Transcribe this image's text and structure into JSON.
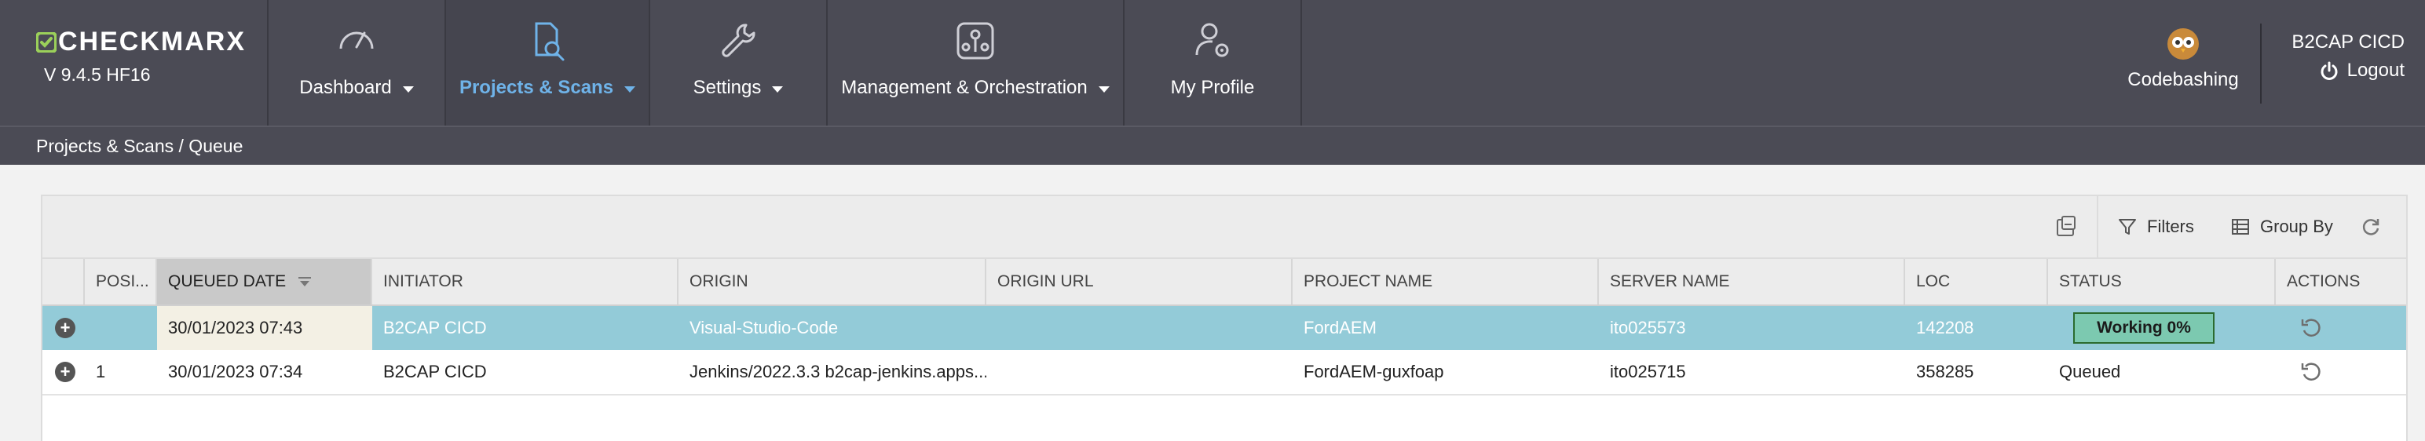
{
  "app": {
    "logo_text": "CHECKMARX",
    "version": "V 9.4.5 HF16"
  },
  "nav": [
    {
      "label": "Dashboard",
      "icon": "gauge-icon",
      "active": false
    },
    {
      "label": "Projects & Scans",
      "icon": "document-search-icon",
      "active": true
    },
    {
      "label": "Settings",
      "icon": "wrench-icon",
      "active": false
    },
    {
      "label": "Management & Orchestration",
      "icon": "orchestration-icon",
      "active": false
    },
    {
      "label": "My Profile",
      "icon": "user-gear-icon",
      "active": false
    }
  ],
  "codebashing": {
    "label": "Codebashing",
    "icon": "owl-avatar-icon"
  },
  "user": {
    "name": "B2CAP CICD",
    "logout_label": "Logout"
  },
  "breadcrumb": "Projects & Scans / Queue",
  "toolbar": {
    "filters_label": "Filters",
    "group_by_label": "Group By"
  },
  "table": {
    "columns": [
      "POSI...",
      "QUEUED DATE",
      "INITIATOR",
      "ORIGIN",
      "ORIGIN URL",
      "PROJECT NAME",
      "SERVER NAME",
      "LOC",
      "STATUS",
      "ACTIONS"
    ],
    "sorted_column": "QUEUED DATE",
    "rows": [
      {
        "position": "",
        "queued_date": "30/01/2023 07:43",
        "initiator": "B2CAP CICD",
        "origin": "Visual-Studio-Code",
        "origin_url": "",
        "project": "FordAEM",
        "server": "ito025573",
        "loc": "142208",
        "status": "Working 0%",
        "selected": true
      },
      {
        "position": "1",
        "queued_date": "30/01/2023 07:34",
        "initiator": "B2CAP CICD",
        "origin": "Jenkins/2022.3.3 b2cap-jenkins.apps...",
        "origin_url": "",
        "project": "FordAEM-guxfoap",
        "server": "ito025715",
        "loc": "358285",
        "status": "Queued",
        "selected": false
      }
    ]
  },
  "colors": {
    "topbar": "#4b4b55",
    "active_nav": "#6fb3e9",
    "selected_row": "#93cbd8",
    "status_working": "#7cc9b0",
    "logo_accent": "#9bd05a"
  }
}
